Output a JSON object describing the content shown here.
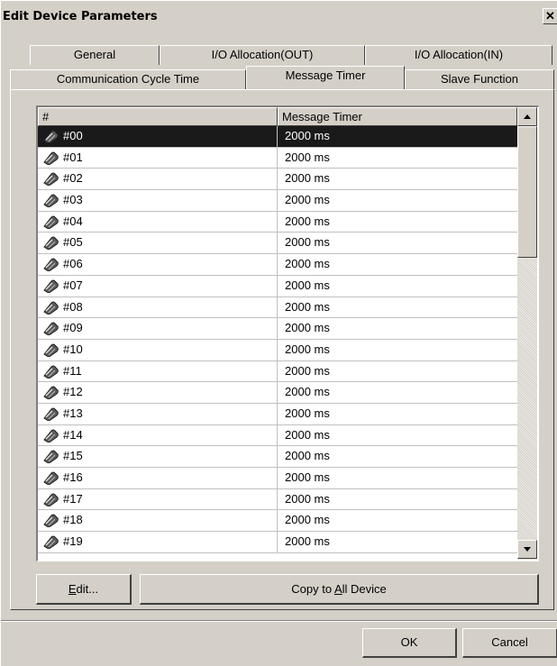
{
  "window": {
    "title": "Edit Device Parameters",
    "close_glyph": "✕"
  },
  "tabs": {
    "row1": [
      "General",
      "I/O Allocation(OUT)",
      "I/O Allocation(IN)"
    ],
    "row2": [
      "Communication Cycle Time",
      "Message Timer",
      "Slave Function"
    ],
    "selected": "Message Timer"
  },
  "grid": {
    "columns": [
      "#",
      "Message Timer"
    ],
    "rows": [
      {
        "id": "#00",
        "value": "2000 ms"
      },
      {
        "id": "#01",
        "value": "2000 ms"
      },
      {
        "id": "#02",
        "value": "2000 ms"
      },
      {
        "id": "#03",
        "value": "2000 ms"
      },
      {
        "id": "#04",
        "value": "2000 ms"
      },
      {
        "id": "#05",
        "value": "2000 ms"
      },
      {
        "id": "#06",
        "value": "2000 ms"
      },
      {
        "id": "#07",
        "value": "2000 ms"
      },
      {
        "id": "#08",
        "value": "2000 ms"
      },
      {
        "id": "#09",
        "value": "2000 ms"
      },
      {
        "id": "#10",
        "value": "2000 ms"
      },
      {
        "id": "#11",
        "value": "2000 ms"
      },
      {
        "id": "#12",
        "value": "2000 ms"
      },
      {
        "id": "#13",
        "value": "2000 ms"
      },
      {
        "id": "#14",
        "value": "2000 ms"
      },
      {
        "id": "#15",
        "value": "2000 ms"
      },
      {
        "id": "#16",
        "value": "2000 ms"
      },
      {
        "id": "#17",
        "value": "2000 ms"
      },
      {
        "id": "#18",
        "value": "2000 ms"
      },
      {
        "id": "#19",
        "value": "2000 ms"
      }
    ],
    "selected_row": "#00",
    "row_icon": "device-icon"
  },
  "actions": {
    "edit": {
      "mnemonic": "E",
      "rest": "dit..."
    },
    "copy": {
      "before": "Copy to ",
      "mnemonic": "A",
      "rest": "ll Device"
    }
  },
  "footer": {
    "ok": "OK",
    "cancel": "Cancel"
  }
}
